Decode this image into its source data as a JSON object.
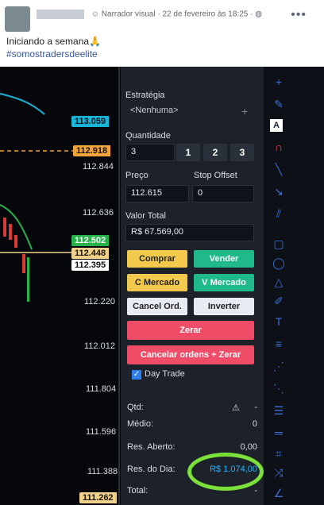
{
  "post": {
    "author_suffix": "Narrador visual",
    "date": "· 22 de fevereiro às 18:25 · ",
    "privacy_icon": "globe-icon",
    "text": "Iniciando a semana🙏",
    "hashtag": "#somostradersdeelite"
  },
  "chart": {
    "price_levels": [
      "112.844",
      "112.636",
      "112.220",
      "112.012",
      "111.804",
      "111.596",
      "111.388"
    ],
    "tags": [
      {
        "value": "113.059",
        "color": "#19b5d8"
      },
      {
        "value": "112.918",
        "color": "#f3a43a"
      },
      {
        "value": "112.502",
        "color": "#27b34b"
      },
      {
        "value": "112.448",
        "color": "#f0d28a"
      },
      {
        "value": "112.395",
        "color": "#ffffff"
      },
      {
        "value": "111.262",
        "color": "#f0d28a"
      }
    ]
  },
  "panel": {
    "strategy_label": "Estratégia",
    "strategy_value": "<Nenhuma>",
    "quantity_label": "Quantidade",
    "quantity_value": "3",
    "qty_buttons": [
      "1",
      "2",
      "3"
    ],
    "price_label": "Preço",
    "price_value": "112.615",
    "stop_offset_label": "Stop Offset",
    "stop_offset_value": "0",
    "total_label": "Valor Total",
    "total_value": "R$ 67.569,00",
    "buy": "Comprar",
    "sell": "Vender",
    "buy_market": "C Mercado",
    "sell_market": "V Mercado",
    "cancel_orders": "Cancel Ord.",
    "invert": "Inverter",
    "zero": "Zerar",
    "cancel_and_zero": "Cancelar ordens + Zerar",
    "day_trade": "Day Trade",
    "qtd_label": "Qtd:",
    "qtd_value": "-",
    "avg_label": "Médio:",
    "avg_value": "0",
    "open_result_label": "Res. Aberto:",
    "open_result_value": "0,00",
    "day_result_label": "Res. do Dia:",
    "day_result_value": "R$ 1.074,00",
    "total_row_label": "Total:",
    "total_row_value": "-"
  },
  "colors": {
    "buy": "#f2c94c",
    "sell": "#1fb98a",
    "zero": "#ef4d67",
    "highlight": "#7be13a"
  }
}
